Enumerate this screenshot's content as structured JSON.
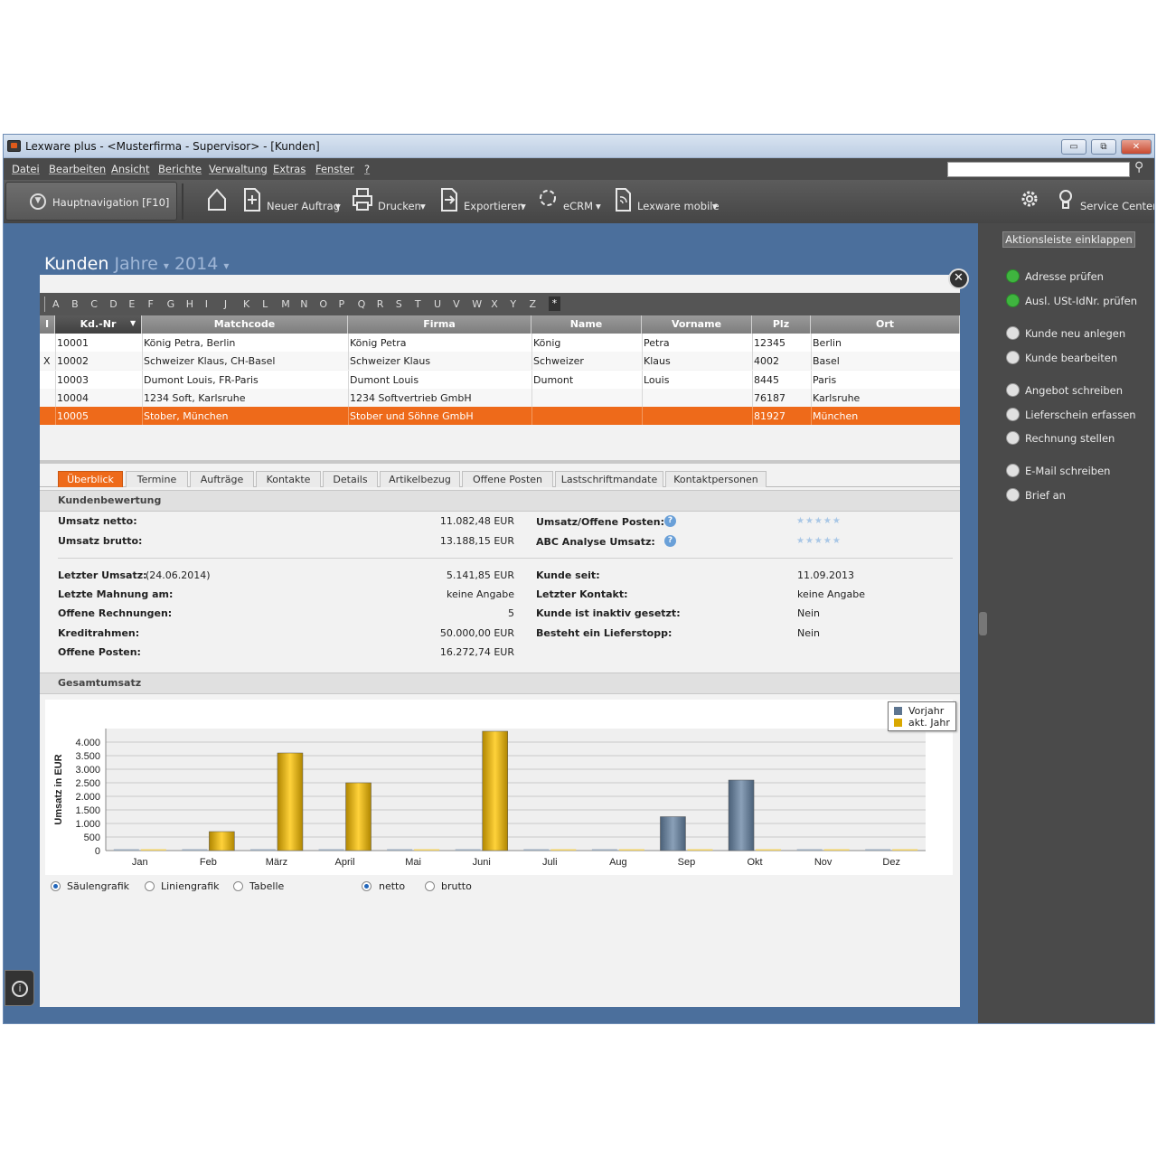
{
  "window": {
    "title": "Lexware plus - <Musterfirma - Supervisor> - [Kunden]",
    "controls": {
      "minimize": "▭",
      "maximize": "⧉",
      "close": "✕"
    }
  },
  "menu": [
    "Datei",
    "Bearbeiten",
    "Ansicht",
    "Berichte",
    "Verwaltung",
    "Extras",
    "Fenster",
    "?"
  ],
  "search": {
    "placeholder": ""
  },
  "toolbar": {
    "hauptnav": "Hauptnavigation [F10]",
    "neuer_auftrag": "Neuer Auftrag",
    "drucken": "Drucken",
    "exportieren": "Exportieren",
    "ecrm": "eCRM",
    "lexware_mobile": "Lexware mobile",
    "service_center": "Service Center",
    "dropdown_glyph": "▾"
  },
  "page": {
    "title": "Kunden",
    "filter_label": "Jahre",
    "filter_year": "2014",
    "dropdown_glyph": "▾"
  },
  "alphabet": [
    "A",
    "B",
    "C",
    "D",
    "E",
    "F",
    "G",
    "H",
    "I",
    "J",
    "K",
    "L",
    "M",
    "N",
    "O",
    "P",
    "Q",
    "R",
    "S",
    "T",
    "U",
    "V",
    "W",
    "X",
    "Y",
    "Z",
    "*"
  ],
  "grid": {
    "columns": [
      "I",
      "Kd.-Nr",
      "Matchcode",
      "Firma",
      "Name",
      "Vorname",
      "Plz",
      "Ort"
    ],
    "rows": [
      {
        "i": "",
        "kdnr": "10001",
        "matchcode": "König Petra, Berlin",
        "firma": "König Petra",
        "name": "König",
        "vorname": "Petra",
        "plz": "12345",
        "ort": "Berlin"
      },
      {
        "i": "X",
        "kdnr": "10002",
        "matchcode": "Schweizer Klaus, CH-Basel",
        "firma": "Schweizer Klaus",
        "name": "Schweizer",
        "vorname": "Klaus",
        "plz": "4002",
        "ort": "Basel"
      },
      {
        "i": "",
        "kdnr": "10003",
        "matchcode": "Dumont Louis, FR-Paris",
        "firma": "Dumont Louis",
        "name": "Dumont",
        "vorname": "Louis",
        "plz": "8445",
        "ort": "Paris"
      },
      {
        "i": "",
        "kdnr": "10004",
        "matchcode": "1234 Soft, Karlsruhe",
        "firma": "1234 Softvertrieb GmbH",
        "name": "",
        "vorname": "",
        "plz": "76187",
        "ort": "Karlsruhe"
      },
      {
        "i": "",
        "kdnr": "10005",
        "matchcode": "Stober, München",
        "firma": "Stober und Söhne GmbH",
        "name": "",
        "vorname": "",
        "plz": "81927",
        "ort": "München"
      }
    ]
  },
  "tabs": [
    "Überblick",
    "Termine",
    "Aufträge",
    "Kontakte",
    "Details",
    "Artikelbezug",
    "Offene Posten",
    "Lastschriftmandate",
    "Kontaktpersonen"
  ],
  "overview": {
    "section1": "Kundenbewertung",
    "umsatz_netto_label": "Umsatz netto:",
    "umsatz_netto_value": "11.082,48 EUR",
    "umsatz_brutto_label": "Umsatz brutto:",
    "umsatz_brutto_value": "13.188,15 EUR",
    "umsatz_op_label": "Umsatz/Offene Posten:",
    "abc_label": "ABC Analyse Umsatz:",
    "stars": "★★★★★",
    "help_glyph": "?",
    "letzter_umsatz_label": "Letzter Umsatz:",
    "letzter_umsatz_date": "(24.06.2014)",
    "letzter_umsatz_value": "5.141,85 EUR",
    "letzte_mahnung_label": "Letzte Mahnung am:",
    "letzte_mahnung_value": "keine Angabe",
    "offene_rechnungen_label": "Offene Rechnungen:",
    "offene_rechnungen_value": "5",
    "kreditrahmen_label": "Kreditrahmen:",
    "kreditrahmen_value": "50.000,00 EUR",
    "offene_posten_label": "Offene Posten:",
    "offene_posten_value": "16.272,74 EUR",
    "kunde_seit_label": "Kunde seit:",
    "kunde_seit_value": "11.09.2013",
    "letzter_kontakt_label": "Letzter Kontakt:",
    "letzter_kontakt_value": "keine Angabe",
    "inaktiv_label": "Kunde ist inaktiv gesetzt:",
    "inaktiv_value": "Nein",
    "lieferstopp_label": "Besteht ein Lieferstopp:",
    "lieferstopp_value": "Nein",
    "section2": "Gesamtumsatz"
  },
  "chart_data": {
    "type": "bar",
    "categories": [
      "Jan",
      "Feb",
      "März",
      "April",
      "Mai",
      "Juni",
      "Juli",
      "Aug",
      "Sep",
      "Okt",
      "Nov",
      "Dez"
    ],
    "series": [
      {
        "name": "Vorjahr",
        "values": [
          0,
          0,
          0,
          0,
          0,
          0,
          0,
          0,
          1250,
          2600,
          0,
          0
        ],
        "color": "#5d7590"
      },
      {
        "name": "akt. Jahr",
        "values": [
          0,
          700,
          3600,
          2500,
          0,
          4400,
          0,
          0,
          0,
          0,
          0,
          0
        ],
        "color": "#d9a800"
      }
    ],
    "ylabel": "Umsatz in EUR",
    "yticks": [
      "0",
      "500",
      "1.000",
      "1.500",
      "2.000",
      "2.500",
      "3.000",
      "3.500",
      "4.000"
    ],
    "ylim": [
      0,
      4500
    ],
    "grid": true,
    "legend": "top-right"
  },
  "chart_options": {
    "saeulengrafik": "Säulengrafik",
    "liniengrafik": "Liniengrafik",
    "tabelle": "Tabelle",
    "netto": "netto",
    "brutto": "brutto"
  },
  "sidebar": {
    "collapse": "Aktionsleiste einklappen",
    "actions": [
      "Adresse prüfen",
      "Ausl. USt-IdNr. prüfen",
      "Kunde neu anlegen",
      "Kunde bearbeiten",
      "Angebot schreiben",
      "Lieferschein erfassen",
      "Rechnung stellen",
      "E-Mail schreiben",
      "Brief an"
    ]
  },
  "panel_close_glyph": "✕",
  "info_glyph": "i"
}
